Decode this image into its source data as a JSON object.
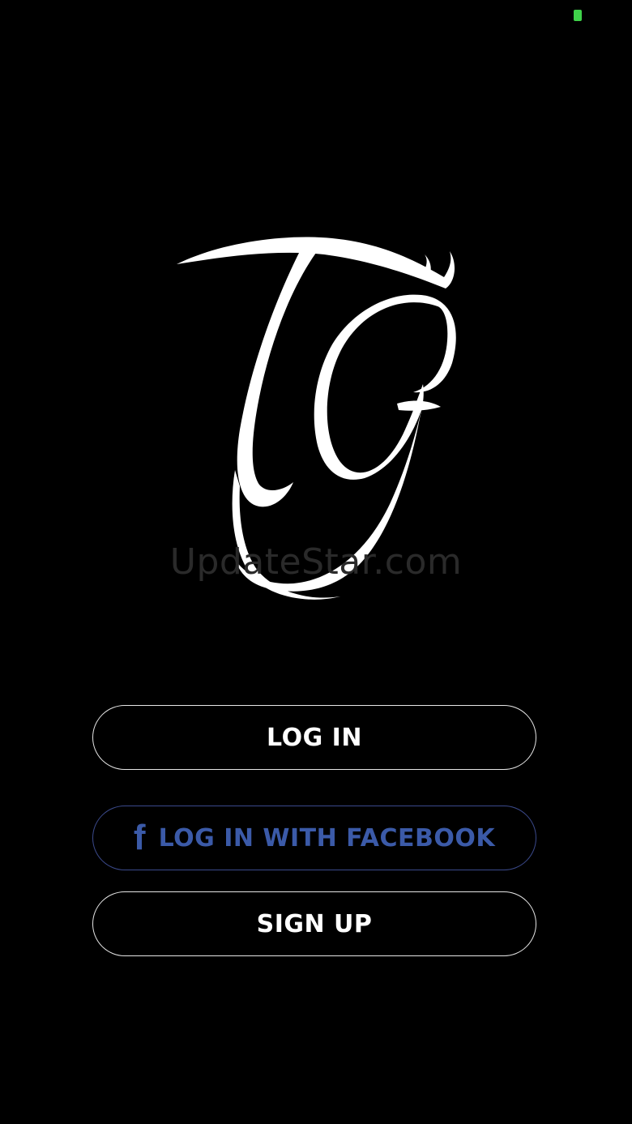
{
  "status_bar": {
    "battery_icon": "battery-icon",
    "battery_color": "#3fd24a"
  },
  "logo": {
    "icon": "tg-logo-icon",
    "letters": "TG"
  },
  "watermark": {
    "text": "UpdateStar.com"
  },
  "buttons": {
    "login_label": "LOG IN",
    "facebook_label": "LOG IN WITH FACEBOOK",
    "facebook_icon": "facebook-f-icon",
    "facebook_glyph": "f",
    "facebook_color": "#3b5aa8",
    "signup_label": "SIGN UP"
  },
  "colors": {
    "background": "#000000",
    "button_border": "#e6e6e6",
    "text": "#ffffff"
  }
}
